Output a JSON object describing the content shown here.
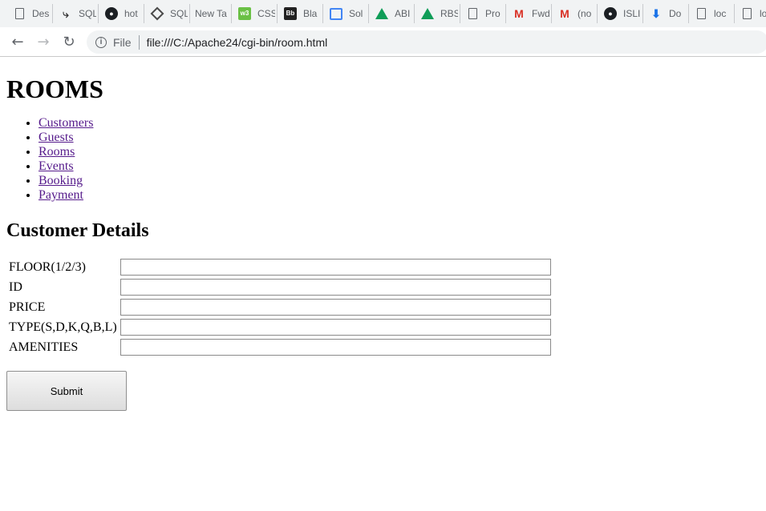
{
  "bookmarks": [
    {
      "icon": "page-icon",
      "label": "Des"
    },
    {
      "icon": "sqlite-icon",
      "label": "SQL"
    },
    {
      "icon": "github-icon",
      "label": "hot"
    },
    {
      "icon": "diamond-icon",
      "label": "SQL"
    },
    {
      "icon": "none",
      "label": "New Tab"
    },
    {
      "icon": "w3schools-icon",
      "label": "CSS"
    },
    {
      "icon": "blackboard-icon",
      "label": "Bla"
    },
    {
      "icon": "slides-icon",
      "label": "Sol"
    },
    {
      "icon": "drive-icon",
      "label": "ABI"
    },
    {
      "icon": "drive-icon",
      "label": "RBS"
    },
    {
      "icon": "page-icon",
      "label": "Pro"
    },
    {
      "icon": "gmail-icon",
      "label": "Fwd"
    },
    {
      "icon": "gmail-icon",
      "label": "(no"
    },
    {
      "icon": "github-icon",
      "label": "ISLI"
    },
    {
      "icon": "download-icon",
      "label": "Do"
    },
    {
      "icon": "page-icon",
      "label": "loc"
    },
    {
      "icon": "page-icon",
      "label": "lo"
    }
  ],
  "address_bar": {
    "scheme": "File",
    "url": "file:///C:/Apache24/cgi-bin/room.html"
  },
  "page": {
    "heading": "ROOMS",
    "nav_links": [
      "Customers",
      "Guests",
      "Rooms",
      "Events",
      "Booking",
      "Payment"
    ],
    "section_title": "Customer Details",
    "fields": [
      {
        "label": "FLOOR(1/2/3)",
        "value": ""
      },
      {
        "label": "ID",
        "value": ""
      },
      {
        "label": "PRICE",
        "value": ""
      },
      {
        "label": "TYPE(S,D,K,Q,B,L)",
        "value": ""
      },
      {
        "label": "AMENITIES",
        "value": ""
      }
    ],
    "submit_label": "Submit"
  },
  "colors": {
    "visited_link": "#551a8b",
    "chrome_bar": "#f1f3f4"
  }
}
